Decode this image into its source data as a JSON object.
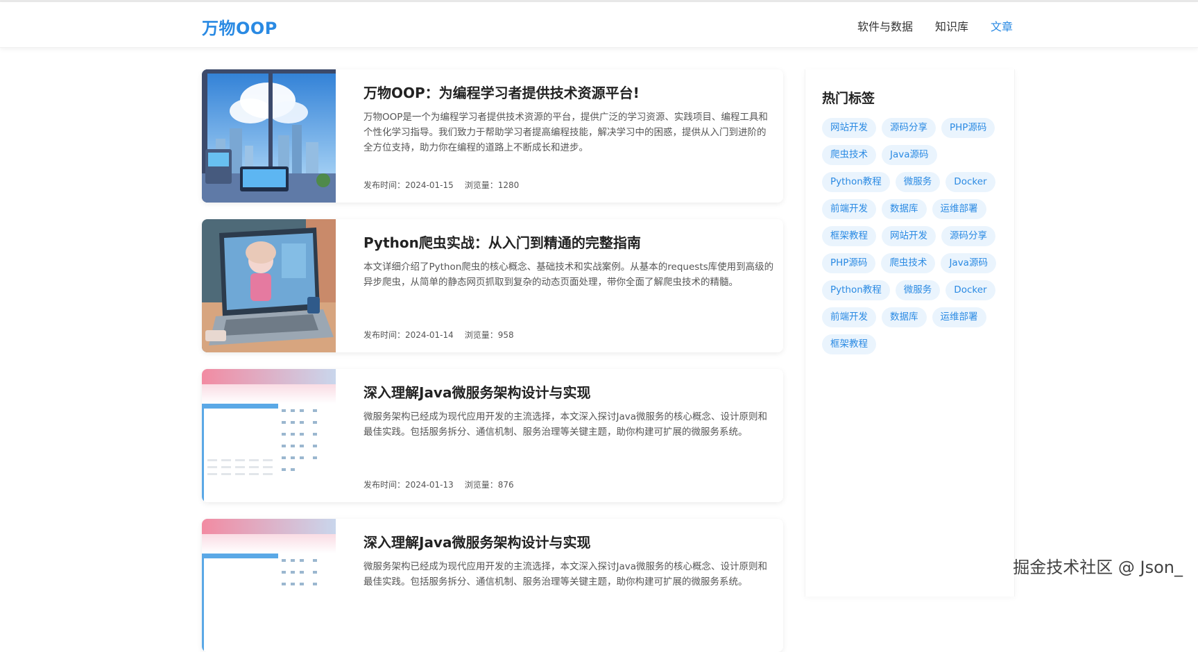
{
  "site": {
    "logo": "万物OOP",
    "nav": [
      "软件与数据",
      "知识库",
      "文章"
    ],
    "active_nav_index": 2
  },
  "articles": [
    {
      "title": "万物OOP：为编程学习者提供技术资源平台!",
      "desc": "万物OOP是一个为编程学习者提供技术资源的平台，提供广泛的学习资源、实践项目、编程工具和个性化学习指导。我们致力于帮助学习者提高编程技能，解决学习中的困惑，提供从入门到进阶的全方位支持，助力你在编程的道路上不断成长和进步。",
      "date": "发布时间：2024-01-15",
      "views": "浏览量：1280",
      "thumb": "city-window-illustration"
    },
    {
      "title": "Python爬虫实战：从入门到精通的完整指南",
      "desc": "本文详细介绍了Python爬虫的核心概念、基础技术和实战案例。从基本的requests库使用到高级的异步爬虫，从简单的静态网页抓取到复杂的动态页面处理，带你全面了解爬虫技术的精髓。",
      "date": "发布时间：2024-01-14",
      "views": "浏览量：958",
      "thumb": "laptop-anime-illustration"
    },
    {
      "title": "深入理解Java微服务架构设计与实现",
      "desc": "微服务架构已经成为现代应用开发的主流选择，本文深入探讨Java微服务的核心概念、设计原则和最佳实践。包括服务拆分、通信机制、服务治理等关键主题，助你构建可扩展的微服务系统。",
      "date": "发布时间：2024-01-13",
      "views": "浏览量：876",
      "thumb": "dashboard-screenshot"
    },
    {
      "title": "深入理解Java微服务架构设计与实现",
      "desc": "微服务架构已经成为现代应用开发的主流选择，本文深入探讨Java微服务的核心概念、设计原则和最佳实践。包括服务拆分、通信机制、服务治理等关键主题，助你构建可扩展的微服务系统。",
      "date": "",
      "views": "",
      "thumb": "dashboard-screenshot"
    }
  ],
  "sidebar": {
    "title": "热门标签",
    "tags": [
      "网站开发",
      "源码分享",
      "PHP源码",
      "爬虫技术",
      "Java源码",
      "Python教程",
      "微服务",
      "Docker",
      "前端开发",
      "数据库",
      "运维部署",
      "框架教程",
      "网站开发",
      "源码分享",
      "PHP源码",
      "爬虫技术",
      "Java源码",
      "Python教程",
      "微服务",
      "Docker",
      "前端开发",
      "数据库",
      "运维部署",
      "框架教程"
    ]
  },
  "watermark": "掘金技术社区 @ Json_",
  "colors": {
    "accent": "#2a8ae3",
    "tag_bg": "#eaf4fd"
  }
}
